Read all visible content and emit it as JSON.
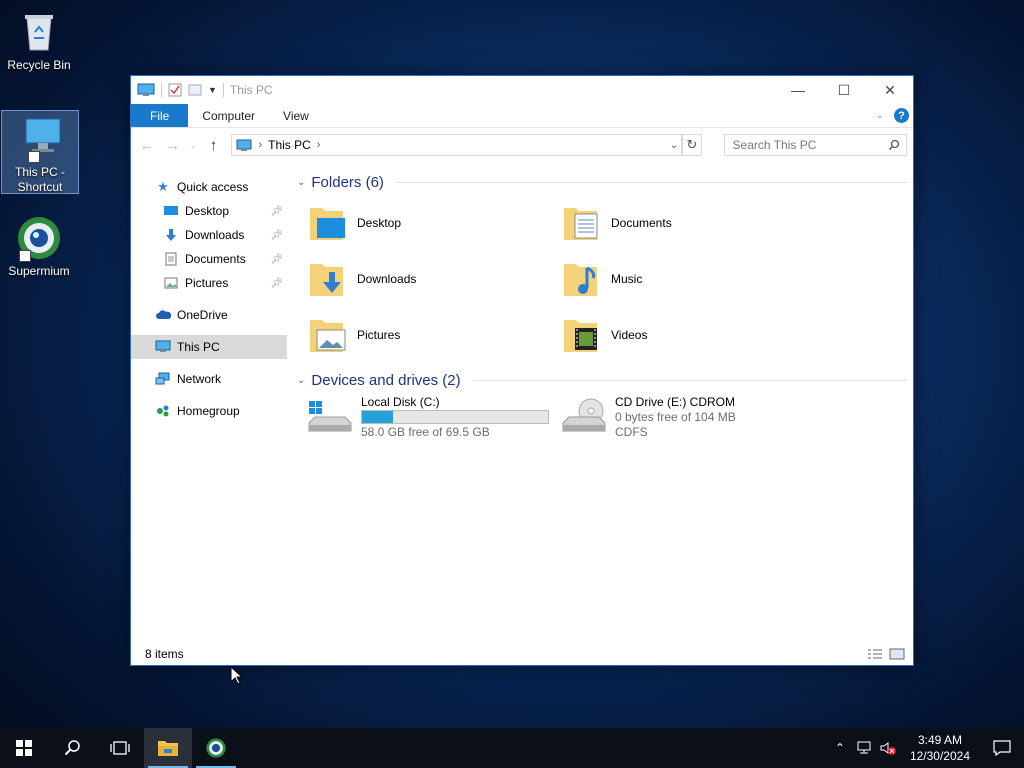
{
  "desktop": {
    "icons": [
      {
        "label": "Recycle Bin",
        "icon": "recycle-bin-icon"
      },
      {
        "label": "This PC - Shortcut",
        "icon": "computer-icon"
      },
      {
        "label": "Supermium",
        "icon": "supermium-icon"
      }
    ]
  },
  "window": {
    "title": "This PC",
    "ribbon": {
      "tabs": [
        "File",
        "Computer",
        "View"
      ]
    },
    "address": {
      "crumb": "This PC"
    },
    "search": {
      "placeholder": "Search This PC"
    },
    "nav": [
      {
        "label": "Quick access",
        "icon": "star-icon"
      },
      {
        "label": "Desktop",
        "icon": "desktop-icon",
        "pinned": true
      },
      {
        "label": "Downloads",
        "icon": "download-icon",
        "pinned": true
      },
      {
        "label": "Documents",
        "icon": "document-icon",
        "pinned": true
      },
      {
        "label": "Pictures",
        "icon": "pictures-icon",
        "pinned": true
      },
      {
        "label": "OneDrive",
        "icon": "cloud-icon"
      },
      {
        "label": "This PC",
        "icon": "computer-icon",
        "selected": true
      },
      {
        "label": "Network",
        "icon": "network-icon"
      },
      {
        "label": "Homegroup",
        "icon": "homegroup-icon"
      }
    ],
    "folders_header": "Folders (6)",
    "folders": [
      "Desktop",
      "Documents",
      "Downloads",
      "Music",
      "Pictures",
      "Videos"
    ],
    "drives_header": "Devices and drives (2)",
    "drives": [
      {
        "name": "Local Disk (C:)",
        "free_text": "58.0 GB free of 69.5 GB",
        "used_fraction": 0.166
      },
      {
        "name": "CD Drive (E:) CDROM",
        "free_text": "0 bytes free of 104 MB",
        "fs": "CDFS"
      }
    ],
    "status": {
      "items": "8 items"
    }
  },
  "taskbar": {
    "time": "3:49 AM",
    "date": "12/30/2024"
  },
  "colors": {
    "accent": "#1979ca",
    "group_header": "#1e3287",
    "progress": "#26a0da"
  }
}
